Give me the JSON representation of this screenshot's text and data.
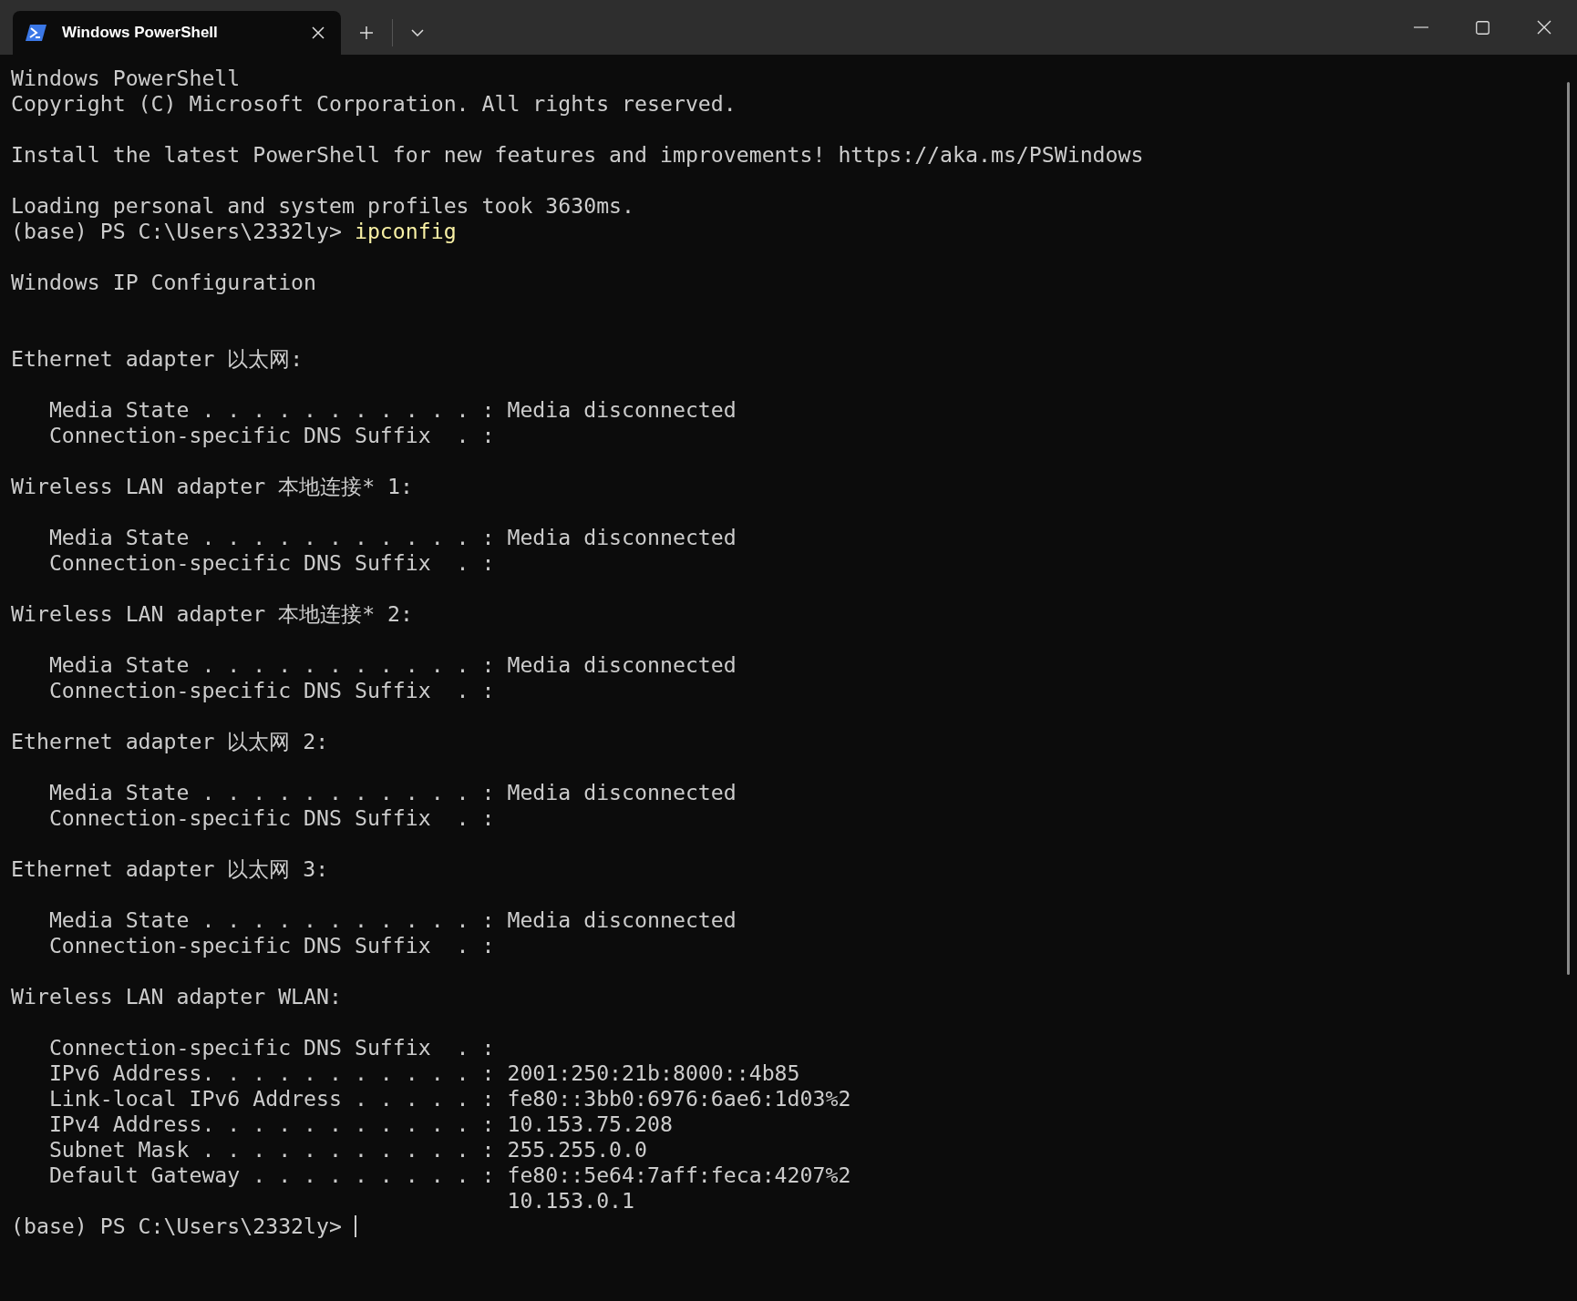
{
  "tabs": [
    {
      "title": "Windows PowerShell",
      "selected": true
    }
  ],
  "terminal": {
    "lines": [
      {
        "kind": "text",
        "text": "Windows PowerShell"
      },
      {
        "kind": "text",
        "text": "Copyright (C) Microsoft Corporation. All rights reserved."
      },
      {
        "kind": "blank"
      },
      {
        "kind": "text",
        "text": "Install the latest PowerShell for new features and improvements! https://aka.ms/PSWindows"
      },
      {
        "kind": "blank"
      },
      {
        "kind": "text",
        "text": "Loading personal and system profiles took 3630ms."
      },
      {
        "kind": "prompt",
        "prompt": "(base) PS C:\\Users\\2332ly> ",
        "command": "ipconfig",
        "cursor": false
      },
      {
        "kind": "blank"
      },
      {
        "kind": "text",
        "text": "Windows IP Configuration"
      },
      {
        "kind": "blank"
      },
      {
        "kind": "blank"
      },
      {
        "kind": "text",
        "text": "Ethernet adapter 以太网:"
      },
      {
        "kind": "blank"
      },
      {
        "kind": "text",
        "text": "   Media State . . . . . . . . . . . : Media disconnected"
      },
      {
        "kind": "text",
        "text": "   Connection-specific DNS Suffix  . :"
      },
      {
        "kind": "blank"
      },
      {
        "kind": "text",
        "text": "Wireless LAN adapter 本地连接* 1:"
      },
      {
        "kind": "blank"
      },
      {
        "kind": "text",
        "text": "   Media State . . . . . . . . . . . : Media disconnected"
      },
      {
        "kind": "text",
        "text": "   Connection-specific DNS Suffix  . :"
      },
      {
        "kind": "blank"
      },
      {
        "kind": "text",
        "text": "Wireless LAN adapter 本地连接* 2:"
      },
      {
        "kind": "blank"
      },
      {
        "kind": "text",
        "text": "   Media State . . . . . . . . . . . : Media disconnected"
      },
      {
        "kind": "text",
        "text": "   Connection-specific DNS Suffix  . :"
      },
      {
        "kind": "blank"
      },
      {
        "kind": "text",
        "text": "Ethernet adapter 以太网 2:"
      },
      {
        "kind": "blank"
      },
      {
        "kind": "text",
        "text": "   Media State . . . . . . . . . . . : Media disconnected"
      },
      {
        "kind": "text",
        "text": "   Connection-specific DNS Suffix  . :"
      },
      {
        "kind": "blank"
      },
      {
        "kind": "text",
        "text": "Ethernet adapter 以太网 3:"
      },
      {
        "kind": "blank"
      },
      {
        "kind": "text",
        "text": "   Media State . . . . . . . . . . . : Media disconnected"
      },
      {
        "kind": "text",
        "text": "   Connection-specific DNS Suffix  . :"
      },
      {
        "kind": "blank"
      },
      {
        "kind": "text",
        "text": "Wireless LAN adapter WLAN:"
      },
      {
        "kind": "blank"
      },
      {
        "kind": "text",
        "text": "   Connection-specific DNS Suffix  . :"
      },
      {
        "kind": "text",
        "text": "   IPv6 Address. . . . . . . . . . . : 2001:250:21b:8000::4b85"
      },
      {
        "kind": "text",
        "text": "   Link-local IPv6 Address . . . . . : fe80::3bb0:6976:6ae6:1d03%2"
      },
      {
        "kind": "text",
        "text": "   IPv4 Address. . . . . . . . . . . : 10.153.75.208"
      },
      {
        "kind": "text",
        "text": "   Subnet Mask . . . . . . . . . . . : 255.255.0.0"
      },
      {
        "kind": "text",
        "text": "   Default Gateway . . . . . . . . . : fe80::5e64:7aff:feca:4207%2"
      },
      {
        "kind": "text",
        "text": "                                       10.153.0.1"
      },
      {
        "kind": "prompt",
        "prompt": "(base) PS C:\\Users\\2332ly> ",
        "cursor": true
      }
    ]
  }
}
